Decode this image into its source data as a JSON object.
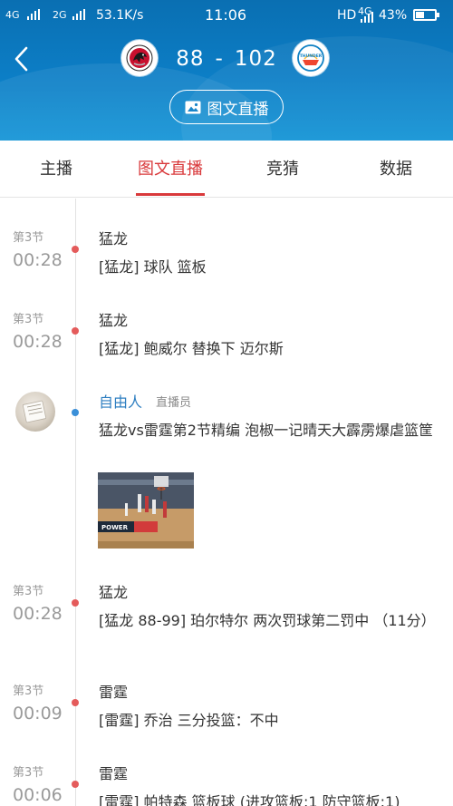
{
  "status_bar": {
    "net1": "4G",
    "net2": "2G",
    "speed": "53.1K/s",
    "time": "11:06",
    "hd": "HD",
    "net3": "4G",
    "battery": "43%"
  },
  "header": {
    "home_score": "88",
    "separator": "-",
    "away_score": "102",
    "live_button_label": "图文直播",
    "home_logo_icon": "raptors-logo-icon",
    "away_logo_icon": "thunder-logo-icon",
    "away_logo_text": "THUNDER"
  },
  "tabs": [
    {
      "label": "主播"
    },
    {
      "label": "图文直播",
      "active": true
    },
    {
      "label": "竞猜"
    },
    {
      "label": "数据"
    }
  ],
  "colors": {
    "header_blue": "#0c7ec6",
    "accent_red": "#d9393b",
    "author_blue": "#2f7fc1",
    "dot_red": "#e45b5b",
    "dot_blue": "#3a8fd8"
  },
  "feed": [
    {
      "quarter": "第3节",
      "time": "00:28",
      "team": "猛龙",
      "text": "[猛龙] 球队 篮板"
    },
    {
      "quarter": "第3节",
      "time": "00:28",
      "team": "猛龙",
      "text": "[猛龙] 鲍威尔 替换下 迈尔斯"
    },
    {
      "author": "自由人",
      "role": "直播员",
      "title": "猛龙vs雷霆第2节精编 泡椒一记晴天大霹雳爆虐篮筐",
      "thumb_caption": "POWER"
    },
    {
      "quarter": "第3节",
      "time": "00:28",
      "team": "猛龙",
      "text": "[猛龙 88-99] 珀尔特尔 两次罚球第二罚中 （11分）"
    },
    {
      "quarter": "第3节",
      "time": "00:09",
      "team": "雷霆",
      "text": "[雷霆] 乔治 三分投篮：不中"
    },
    {
      "quarter": "第3节",
      "time": "00:06",
      "team": "雷霆",
      "text": "[雷霆] 帕特森 篮板球 (进攻篮板:1 防守篮板:1)"
    }
  ]
}
